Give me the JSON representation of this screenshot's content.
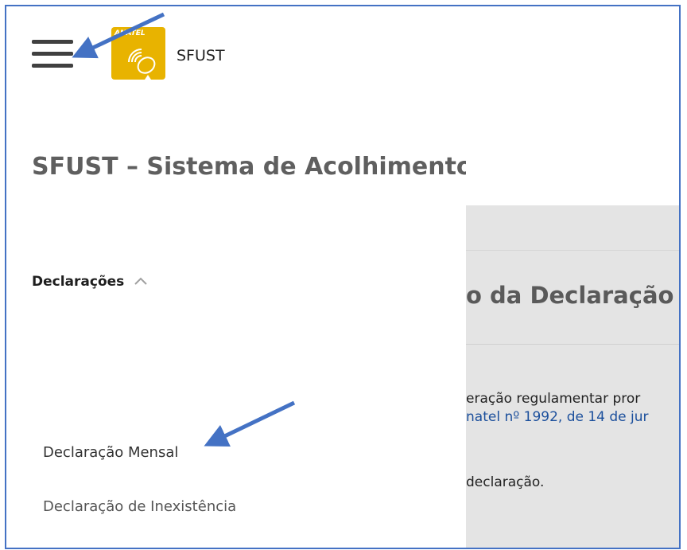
{
  "header": {
    "menu_icon": "hamburger-menu-icon",
    "logo_text": "ANATEL",
    "app_name": "SFUST"
  },
  "panel": {
    "system_title": "SFUST – Sistema de Acolhimento",
    "section_label": "Declarações",
    "section_icon": "chevron-up-icon",
    "items": [
      {
        "label": "Declaração Mensal"
      },
      {
        "label": "Declaração de Inexistência"
      }
    ]
  },
  "background_page": {
    "heading": "o da Declaração",
    "line1": "eração regulamentar pror",
    "line2": "natel nº 1992, de 14 de jur",
    "line3": "declaração."
  },
  "colors": {
    "annotation_arrow": "#4472c4",
    "logo_bg": "#e8b300",
    "frame_border": "#4472c4"
  }
}
